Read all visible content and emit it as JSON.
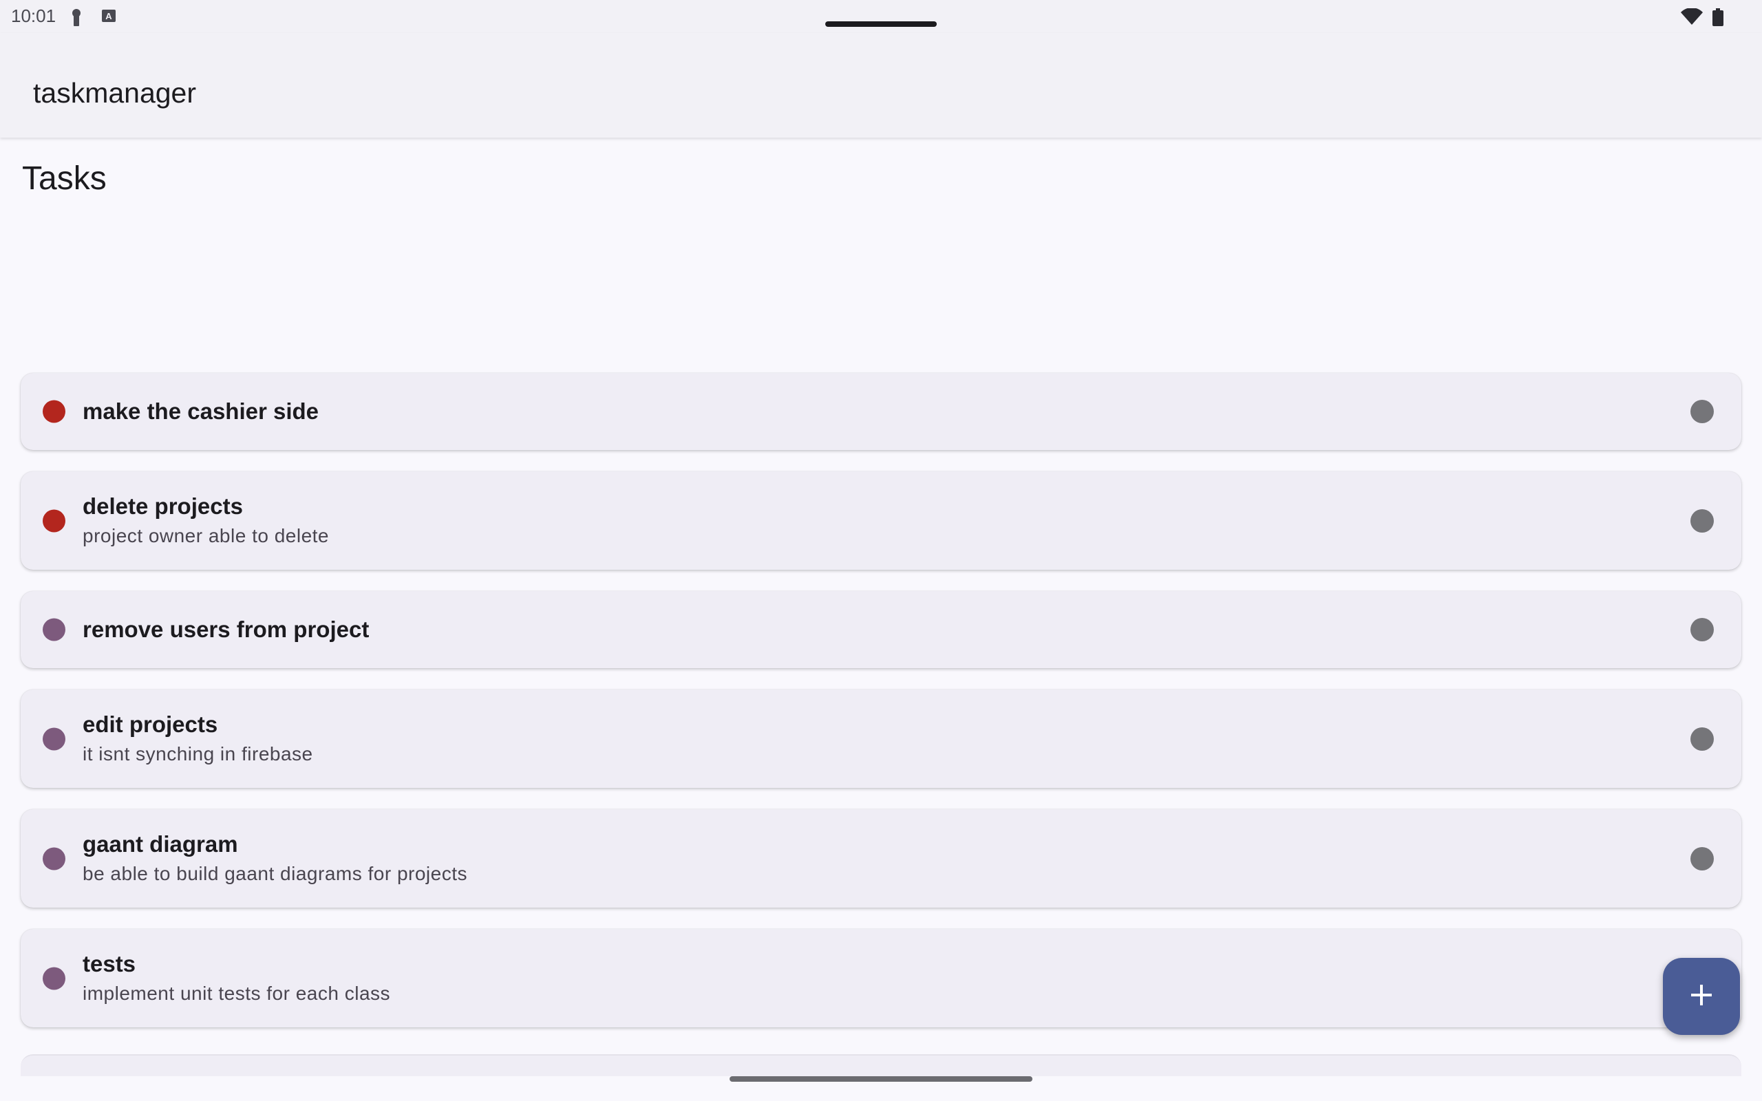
{
  "status_bar": {
    "time": "10:01",
    "left_icons": [
      "key-icon",
      "keyboard-a-icon"
    ],
    "right_icons": [
      "wifi-icon",
      "battery-icon"
    ]
  },
  "app_bar": {
    "title": "taskmanager"
  },
  "section": {
    "title": "Tasks"
  },
  "tasks": [
    {
      "title": "make the cashier side",
      "description": "",
      "priority_color": "#b3261e"
    },
    {
      "title": "delete projects",
      "description": "project owner able to delete",
      "priority_color": "#b3261e"
    },
    {
      "title": "remove users from project",
      "description": "",
      "priority_color": "#7d5a7d"
    },
    {
      "title": "edit projects",
      "description": "it isnt synching in firebase",
      "priority_color": "#7d5a7d"
    },
    {
      "title": "gaant diagram",
      "description": "be able to build gaant diagrams for projects",
      "priority_color": "#7d5a7d"
    },
    {
      "title": "tests",
      "description": "implement unit tests for each class",
      "priority_color": "#7d5a7d"
    }
  ],
  "fab": {
    "icon": "plus-icon",
    "color": "#4a5c96"
  }
}
